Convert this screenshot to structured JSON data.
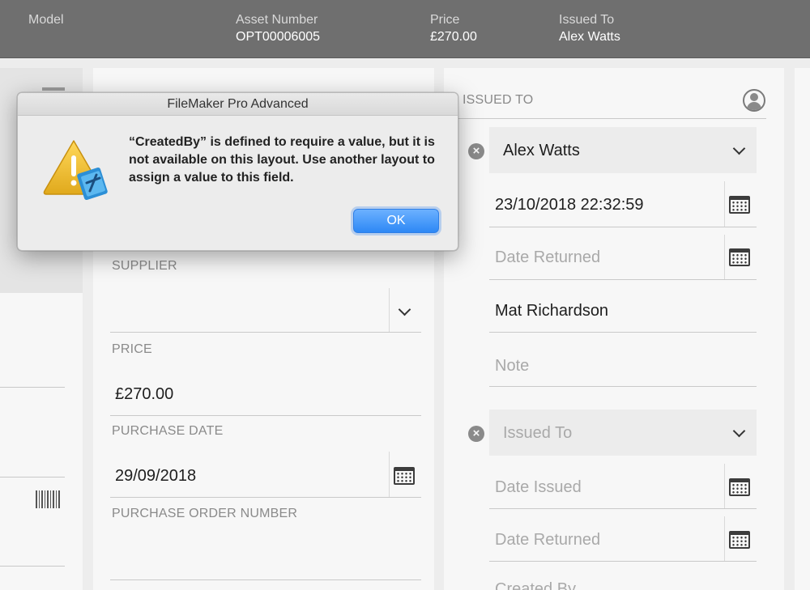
{
  "header": {
    "model_label": "Model",
    "asset_label": "Asset Number",
    "asset_value": "OPT00006005",
    "price_label": "Price",
    "price_value": "£270.00",
    "issued_label": "Issued To",
    "issued_value": "Alex Watts"
  },
  "middle": {
    "supplier_label": "SUPPLIER",
    "supplier_value": "",
    "price_label": "PRICE",
    "price_value": "£270.00",
    "purchase_date_label": "PURCHASE DATE",
    "purchase_date_value": "29/09/2018",
    "po_label": "PURCHASE ORDER NUMBER",
    "po_value": ""
  },
  "right": {
    "section_label": "ISSUED TO",
    "entry1": {
      "issued_to": "Alex Watts",
      "date_issued": "23/10/2018 22:32:59",
      "date_returned_placeholder": "Date Returned",
      "issued_by": "Mat Richardson",
      "note_placeholder": "Note"
    },
    "entry2": {
      "issued_to_placeholder": "Issued To",
      "date_issued_placeholder": "Date Issued",
      "date_returned_placeholder": "Date Returned",
      "created_by_partial": "Created By"
    }
  },
  "dialog": {
    "title": "FileMaker Pro Advanced",
    "message": "“CreatedBy” is defined to require a value, but it is not available on this layout. Use another layout to assign a value to this field.",
    "ok_label": "OK"
  },
  "colors": {
    "header_bg": "#6f6f6f",
    "accent_button": "#2d88f5"
  }
}
